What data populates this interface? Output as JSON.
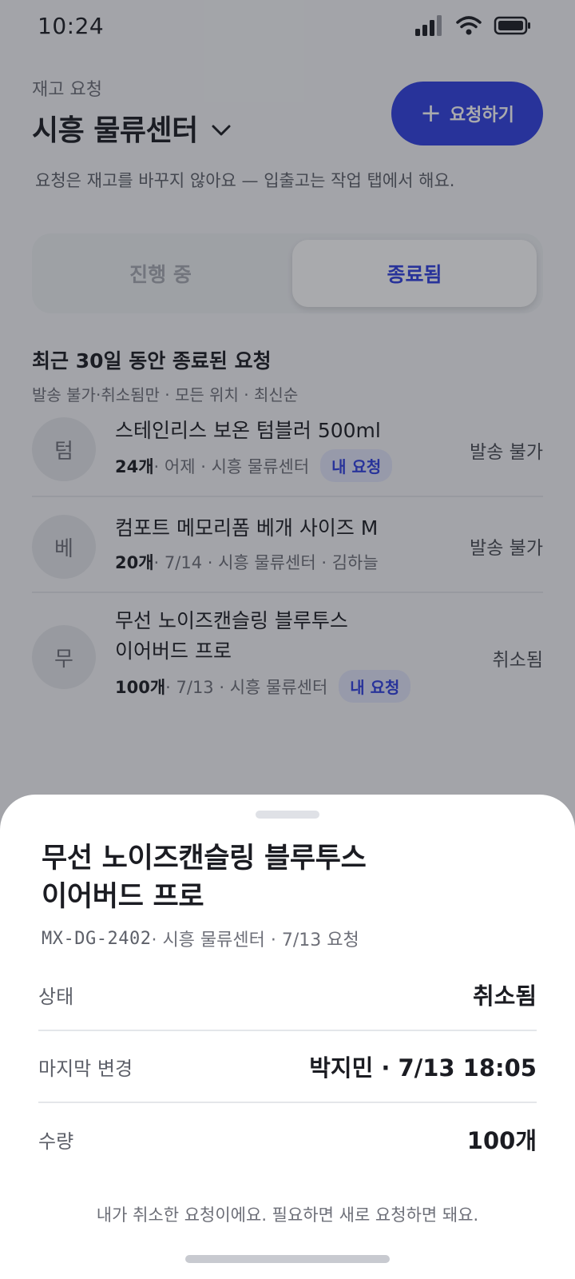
{
  "status_bar": {
    "time": "10:24"
  },
  "header": {
    "subtitle": "재고 요청",
    "title": "시흥 물류센터",
    "request_button": "요청하기",
    "hint": "요청은 재고를 바꾸지 않아요 — 입출고는 작업 탭에서 해요."
  },
  "tabs": [
    {
      "label": "진행 중",
      "active": false
    },
    {
      "label": "종료됨",
      "active": true
    }
  ],
  "section": {
    "title": "최근 30일 동안 종료된 요청",
    "subtitle": "발송 불가·취소됨만 · 모든 위치 · 최신순"
  },
  "requests": [
    {
      "avatar": "텀",
      "name_lines": [
        "스테인리스 보온 텀블러 500ml"
      ],
      "qty": "24개",
      "meta": " · 어제 · 시흥 물류센터",
      "badge": "내 요청",
      "status": "발송 불가"
    },
    {
      "avatar": "베",
      "name_lines": [
        "컴포트 메모리폼 베개 사이즈 M"
      ],
      "qty": "20개",
      "meta": " · 7/14 · 시흥 물류센터 · 김하늘",
      "badge": "",
      "status": "발송 불가"
    },
    {
      "avatar": "무",
      "name_lines": [
        "무선 노이즈캔슬링 블루투스",
        "이어버드 프로"
      ],
      "qty": "100개",
      "meta": " · 7/13 · 시흥 물류센터",
      "badge": "내 요청",
      "status": "취소됨"
    }
  ],
  "sheet": {
    "title_line1": "무선 노이즈캔슬링 블루투스",
    "title_line2": "이어버드 프로",
    "sku": "MX-DG-2402",
    "sub": " · 시흥 물류센터 · 7/13 요청",
    "details": [
      {
        "label": "상태",
        "value": "취소됨"
      },
      {
        "label": "마지막 변경",
        "value": "박지민 · 7/13 18:05"
      },
      {
        "label": "수량",
        "value": "100개"
      }
    ],
    "note": "내가 취소한 요청이에요. 필요하면 새로 요청하면 돼요."
  },
  "colors": {
    "accent": "#2f3fe0",
    "badge_bg": "#e3e6fb",
    "overlay": "rgba(30,32,40,0.38)"
  }
}
